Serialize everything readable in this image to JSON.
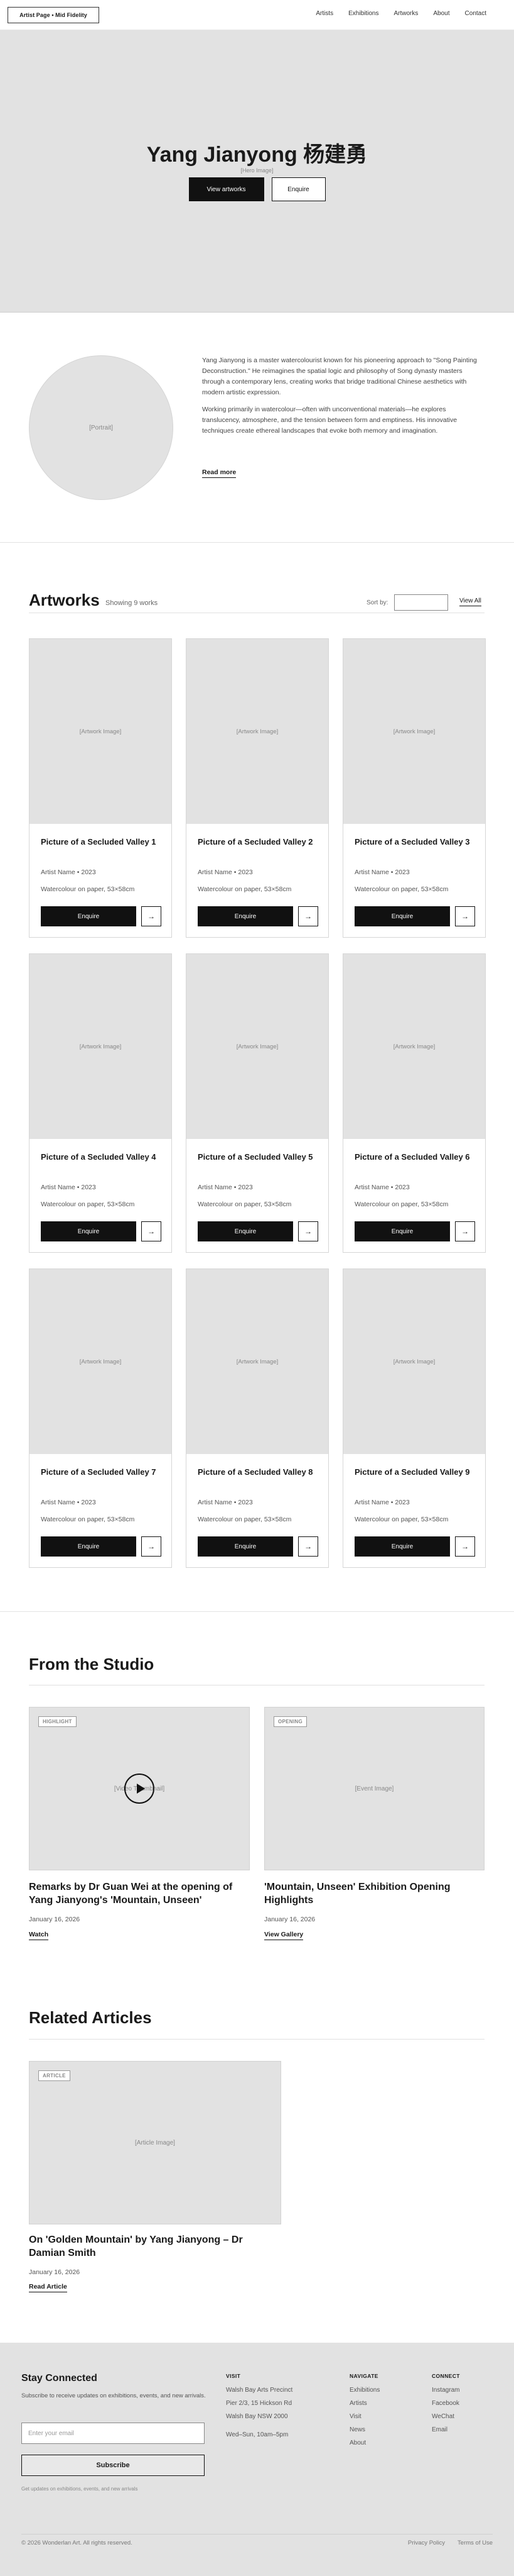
{
  "header": {
    "brand": "Artist Page • Mid Fidelity",
    "nav": [
      "Artists",
      "Exhibitions",
      "Artworks",
      "About",
      "Contact"
    ]
  },
  "hero": {
    "title": "Yang Jianyong 杨建勇",
    "placeholder": "[Hero Image]",
    "primary_button": "View artworks",
    "secondary_button": "Enquire"
  },
  "about": {
    "portrait_placeholder": "[Portrait]",
    "paragraph_1": "Yang Jianyong is a master watercolourist known for his pioneering approach to \"Song Painting Deconstruction.\" He reimagines the spatial logic and philosophy of Song dynasty masters through a contemporary lens, creating works that bridge traditional Chinese aesthetics with modern artistic expression.",
    "paragraph_2": "Working primarily in watercolour—often with unconventional materials—he explores translucency, atmosphere, and the tension between form and emptiness. His innovative techniques create ethereal landscapes that evoke both memory and imagination.",
    "read_more": "Read more"
  },
  "artworks": {
    "title": "Artworks",
    "count": "Showing 9 works",
    "sort_label": "Sort by:",
    "view_all": "View All",
    "image_placeholder": "[Artwork Image]",
    "enquire_label": "Enquire",
    "arrow": "→",
    "items": [
      {
        "title": "Picture of a Secluded Valley 1",
        "meta": "Artist Name • 2023",
        "medium": "Watercolour on paper, 53×58cm"
      },
      {
        "title": "Picture of a Secluded Valley 2",
        "meta": "Artist Name • 2023",
        "medium": "Watercolour on paper, 53×58cm"
      },
      {
        "title": "Picture of a Secluded Valley 3",
        "meta": "Artist Name • 2023",
        "medium": "Watercolour on paper, 53×58cm"
      },
      {
        "title": "Picture of a Secluded Valley 4",
        "meta": "Artist Name • 2023",
        "medium": "Watercolour on paper, 53×58cm"
      },
      {
        "title": "Picture of a Secluded Valley 5",
        "meta": "Artist Name • 2023",
        "medium": "Watercolour on paper, 53×58cm"
      },
      {
        "title": "Picture of a Secluded Valley 6",
        "meta": "Artist Name • 2023",
        "medium": "Watercolour on paper, 53×58cm"
      },
      {
        "title": "Picture of a Secluded Valley 7",
        "meta": "Artist Name • 2023",
        "medium": "Watercolour on paper, 53×58cm"
      },
      {
        "title": "Picture of a Secluded Valley 8",
        "meta": "Artist Name • 2023",
        "medium": "Watercolour on paper, 53×58cm"
      },
      {
        "title": "Picture of a Secluded Valley 9",
        "meta": "Artist Name • 2023",
        "medium": "Watercolour on paper, 53×58cm"
      }
    ]
  },
  "studio": {
    "title": "From the Studio",
    "posts": [
      {
        "tag": "HIGHLIGHT",
        "placeholder": "[Video Thumbnail]",
        "title": "Remarks by Dr Guan Wei at the opening of Yang Jianyong's 'Mountain, Unseen'",
        "date": "January 16, 2026",
        "link": "Watch"
      },
      {
        "tag": "OPENING",
        "placeholder": "[Event Image]",
        "title": "'Mountain, Unseen' Exhibition Opening Highlights",
        "date": "January 16, 2026",
        "link": "View Gallery"
      }
    ]
  },
  "related": {
    "title": "Related Articles",
    "tag": "ARTICLE",
    "placeholder": "[Article Image]",
    "article_title": "On 'Golden Mountain' by Yang Jianyong – Dr Damian Smith",
    "date": "January 16, 2026",
    "link": "Read Article"
  },
  "footer": {
    "title": "Stay Connected",
    "description": "Subscribe to receive updates on exhibitions, events, and new arrivals.",
    "email_placeholder": "Enter your email",
    "subscribe": "Subscribe",
    "note": "Get updates on exhibitions, events, and new arrivals",
    "visit": {
      "heading": "VISIT",
      "lines": [
        "Walsh Bay Arts Precinct",
        "Pier 2/3, 15 Hickson Rd",
        "Walsh Bay NSW 2000",
        "Wed–Sun, 10am–5pm"
      ]
    },
    "navigate": {
      "heading": "NAVIGATE",
      "links": [
        "Exhibitions",
        "Artists",
        "Visit",
        "News",
        "About"
      ]
    },
    "connect": {
      "heading": "CONNECT",
      "links": [
        "Instagram",
        "Facebook",
        "WeChat",
        "Email"
      ]
    },
    "copyright": "© 2026 Wonderlan Art. All rights reserved.",
    "privacy": "Privacy Policy",
    "terms": "Terms of Use"
  }
}
